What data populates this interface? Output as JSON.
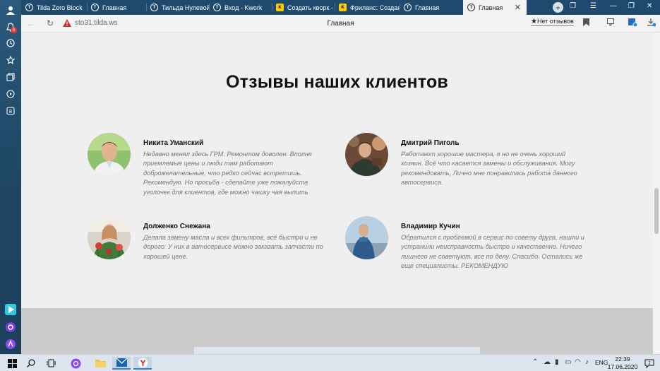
{
  "tabs": [
    {
      "label": "Tilda Zero Block"
    },
    {
      "label": "Главная"
    },
    {
      "label": "Тильда Нулевой"
    },
    {
      "label": "Вход - Kwork"
    },
    {
      "label": "Создать кворк -"
    },
    {
      "label": "Фриланс: Создан"
    },
    {
      "label": "Главная"
    },
    {
      "label": "Главная"
    }
  ],
  "sidebar": {
    "notification_count": "6"
  },
  "address": {
    "url": "sto31.tilda.ws",
    "page_title": "Главная",
    "reviews_label": "Нет отзывов"
  },
  "page": {
    "heading": "Отзывы наших клиентов",
    "reviews": [
      {
        "name": "Никита Уманский",
        "text": "Недавно менял здесь ГРМ. Ремонтом доволен. Вполне приемлемые цены и люди там работают доброжелательные, что редко сейчас встретишь. Рекомендую. Но просьба - сделайте уже пожалуйста уголочек для клиентов, где можно чашку чая выпить"
      },
      {
        "name": "Дмитрий Пиголь",
        "text": "Работают хорошие мастера, я но не очень хороший хозяин. Всё что касается замены и обслуживания. Могу рекомендовать, Лично мне понравилась работа данного автосервиса."
      },
      {
        "name": "Долженко Снежана",
        "text": "Делала замену масла и всех фильтров, всё быстро и не дорого: У них в автосервисе можно заказать запчасти по хорошей цене."
      },
      {
        "name": "Владимир Кучин",
        "text": "Обратился с проблемой в сервис по совету друга, нашли и устранили неисправность быстро и качественно. Ничего лишнего не советуют, все по делу. Спасибо. Остались же еще специалисты. РЕКОМЕНДУЮ"
      }
    ]
  },
  "taskbar": {
    "language": "ENG",
    "time": "22:39",
    "date": "17.06.2020",
    "notifications": "2"
  }
}
